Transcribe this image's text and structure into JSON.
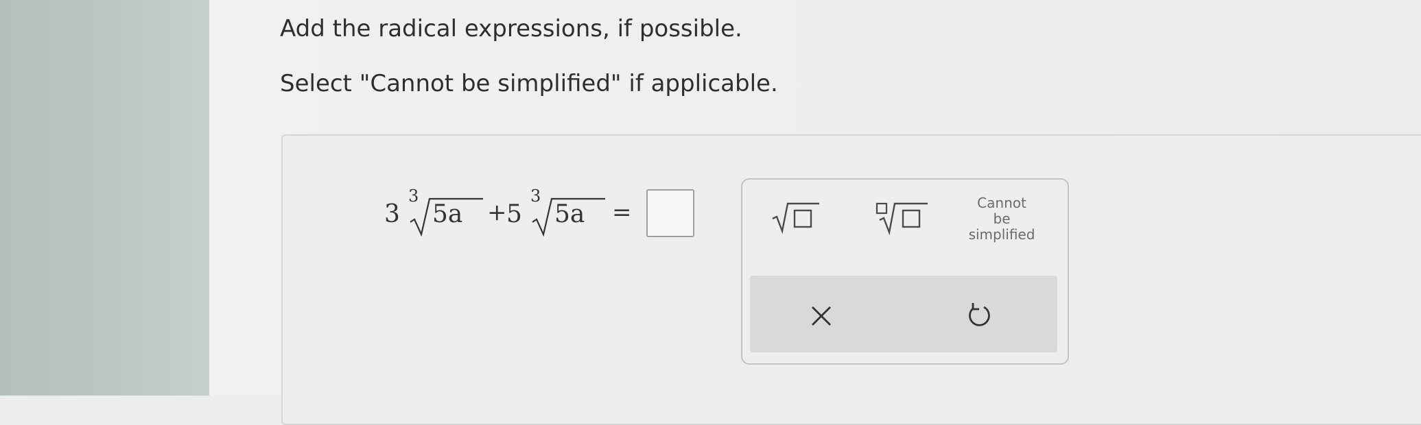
{
  "instructions": {
    "line1": "Add the radical expressions, if possible.",
    "line2": "Select \"Cannot be simplified\" if applicable."
  },
  "problem": {
    "coef1": "3",
    "index1": "3",
    "radicand1": "5a",
    "plus": "+",
    "coef2": "5",
    "index2": "3",
    "radicand2": "5a",
    "equals": "="
  },
  "answer": {
    "value": ""
  },
  "keypad": {
    "buttons": [
      {
        "name": "square-root",
        "icon": "square-root-icon"
      },
      {
        "name": "nth-root",
        "icon": "nth-root-icon"
      },
      {
        "name": "cannot-be-simplified",
        "label": "Cannot be simplified"
      }
    ],
    "cannot_line1": "Cannot",
    "cannot_line2": "be",
    "cannot_line3": "simplified",
    "actions": [
      {
        "name": "clear",
        "icon": "close-icon"
      },
      {
        "name": "undo",
        "icon": "undo-icon"
      }
    ]
  },
  "colors": {
    "text": "#2e2e2e",
    "keypad_border": "#c2c4c4",
    "action_bar": "#d8dad8",
    "icon": "#4a4a4a"
  }
}
